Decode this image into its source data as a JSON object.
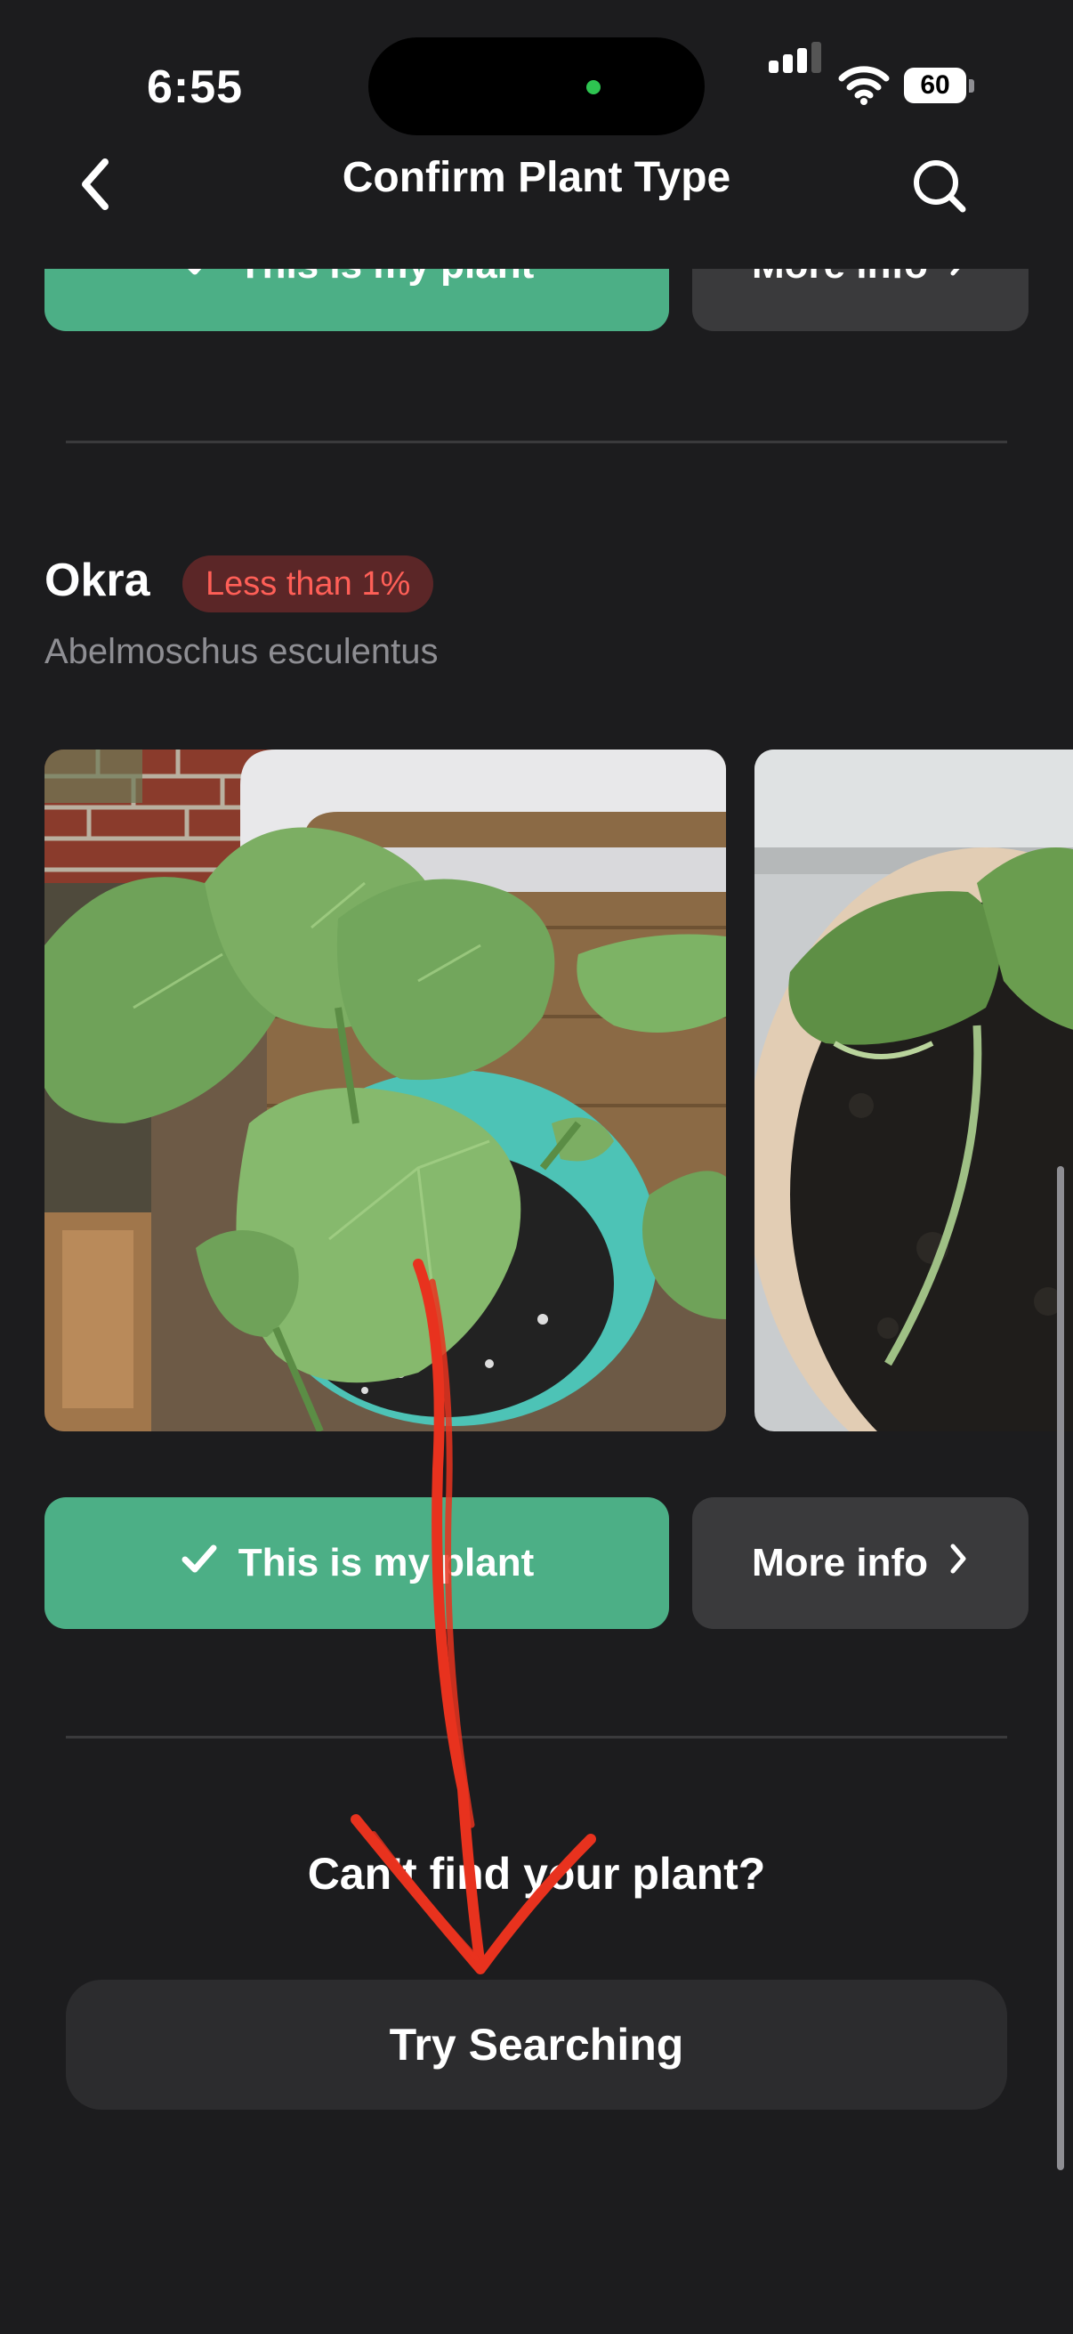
{
  "status_bar": {
    "time": "6:55",
    "battery": "60"
  },
  "nav": {
    "title": "Confirm Plant Type"
  },
  "previous_card": {
    "confirm_label": "This is my plant",
    "more_label": "More info"
  },
  "plant": {
    "name": "Okra",
    "confidence": "Less than 1%",
    "scientific_name": "Abelmoschus esculentus",
    "confirm_label": "This is my plant",
    "more_label": "More info"
  },
  "footer": {
    "prompt": "Can't find your plant?",
    "search_label": "Try Searching"
  },
  "colors": {
    "background": "#1c1c1e",
    "accent_green": "#4caf86",
    "badge_bg": "#5b2627",
    "badge_text": "#ff5f57",
    "annotation_red": "#e8321e"
  },
  "icons": [
    "back-chevron-icon",
    "search-icon",
    "check-icon",
    "chevron-right-icon",
    "signal-icon",
    "wifi-icon",
    "battery-icon"
  ]
}
